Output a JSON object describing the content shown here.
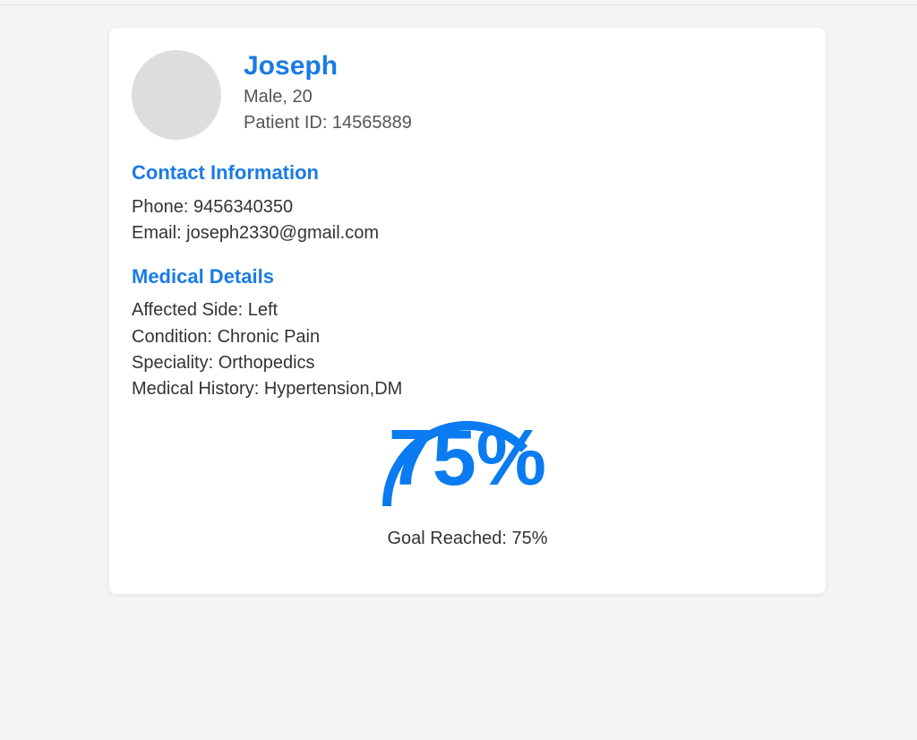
{
  "patient": {
    "name": "Joseph",
    "gender_age": "Male, 20",
    "patient_id": "Patient ID: 14565889"
  },
  "contact": {
    "title": "Contact Information",
    "phone": "Phone: 9456340350",
    "email": "Email: joseph2330@gmail.com"
  },
  "medical": {
    "title": "Medical Details",
    "affected_side": "Affected Side: Left",
    "condition": "Condition: Chronic Pain",
    "speciality": "Speciality: Orthopedics",
    "history": "Medical History: Hypertension,DM"
  },
  "progress": {
    "percent_text": "75%",
    "value": 0.75,
    "goal_text": "Goal Reached: 75%",
    "color": "#0a7bf0"
  },
  "colors": {
    "accent": "#1a7be6",
    "background": "#f4f4f4",
    "avatar": "#dddddd"
  }
}
